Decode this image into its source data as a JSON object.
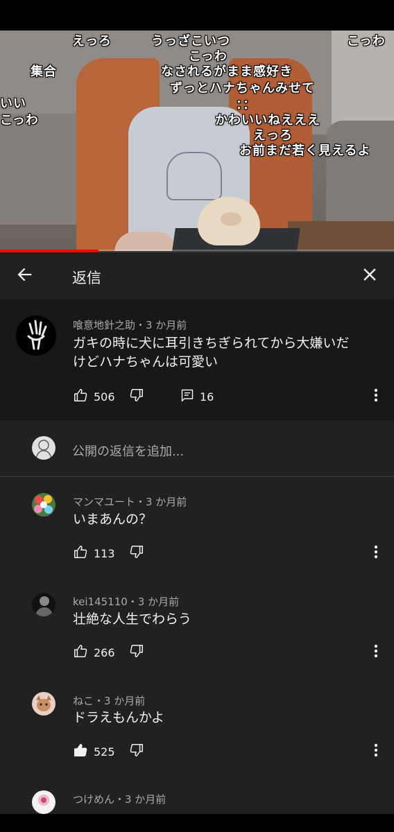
{
  "video": {
    "progress_fraction": 0.25,
    "danmaku": [
      "えっろ",
      "うっざこいつ",
      "こっわ",
      "こっわ",
      "集合",
      "なされるがまま感好き",
      "ずっとハナちゃんみせて",
      "いい",
      "：：",
      "こっわ",
      "かわいいねえええ",
      "えっろ",
      "お前まだ若く見えるよ"
    ]
  },
  "header": {
    "title": "返信"
  },
  "parent_comment": {
    "author": "喰意地針之助・3 か月前",
    "text_line1": "ガキの時に犬に耳引きちぎられてから大嫌いだ",
    "text_line2": "けどハナちゃんは可愛い",
    "likes": "506",
    "replies": "16"
  },
  "reply_input": {
    "placeholder": "公開の返信を追加..."
  },
  "replies": [
    {
      "author": "マンマユート・3 か月前",
      "text": "いまあんの？",
      "likes": "113",
      "liked": false
    },
    {
      "author": "kei145110・3 か月前",
      "text": "壮絶な人生でわらう",
      "likes": "266",
      "liked": false
    },
    {
      "author": "ねこ・3 か月前",
      "text": "ドラえもんかよ",
      "likes": "525",
      "liked": true
    },
    {
      "author": "つけめん・3 か月前",
      "text": ""
    }
  ],
  "icons": {
    "back": "arrow-left-icon",
    "close": "close-icon",
    "like": "thumb-up-icon",
    "dislike": "thumb-down-icon",
    "reply": "comment-icon",
    "more": "more-vert-icon"
  },
  "colors": {
    "accent": "#ff0000",
    "panel": "#212121",
    "parent_bg": "#181818",
    "secondary_text": "#aaaaaa"
  }
}
